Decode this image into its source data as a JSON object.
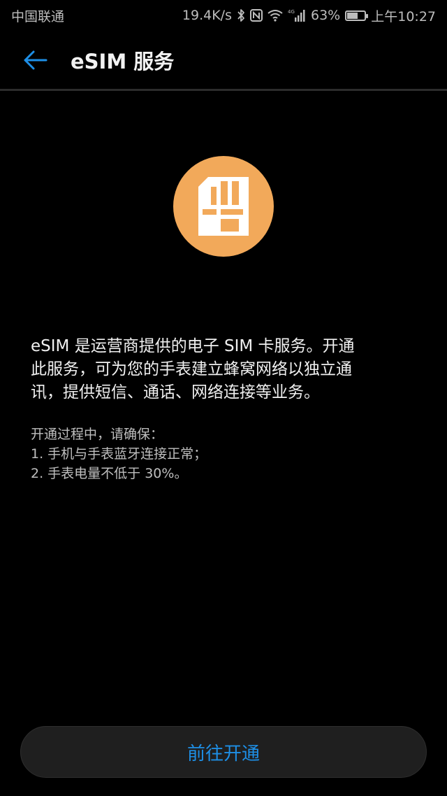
{
  "status_bar": {
    "carrier": "中国联通",
    "network_speed": "19.4K/s",
    "network_type": "4G",
    "battery_percent": "63%",
    "battery_level": 0.63,
    "time": "上午10:27",
    "icons": [
      "bluetooth-icon",
      "nfc-icon",
      "wifi-icon",
      "cellular-signal-icon",
      "battery-icon"
    ]
  },
  "app_bar": {
    "title": "eSIM 服务",
    "back_icon": "back-arrow-icon"
  },
  "hero": {
    "icon": "sim-card-icon",
    "icon_bg_color": "#f2a95a"
  },
  "content": {
    "intro": "eSIM 是运营商提供的电子 SIM 卡服务。开通\n此服务，可为您的手表建立蜂窝网络以独立通\n讯，提供短信、通话、网络连接等业务。",
    "notes": "开通过程中，请确保：\n1. 手机与手表蓝牙连接正常；\n2. 手表电量不低于 30%。"
  },
  "footer": {
    "button_label": "前往开通",
    "accent_color": "#1e8fe6"
  }
}
